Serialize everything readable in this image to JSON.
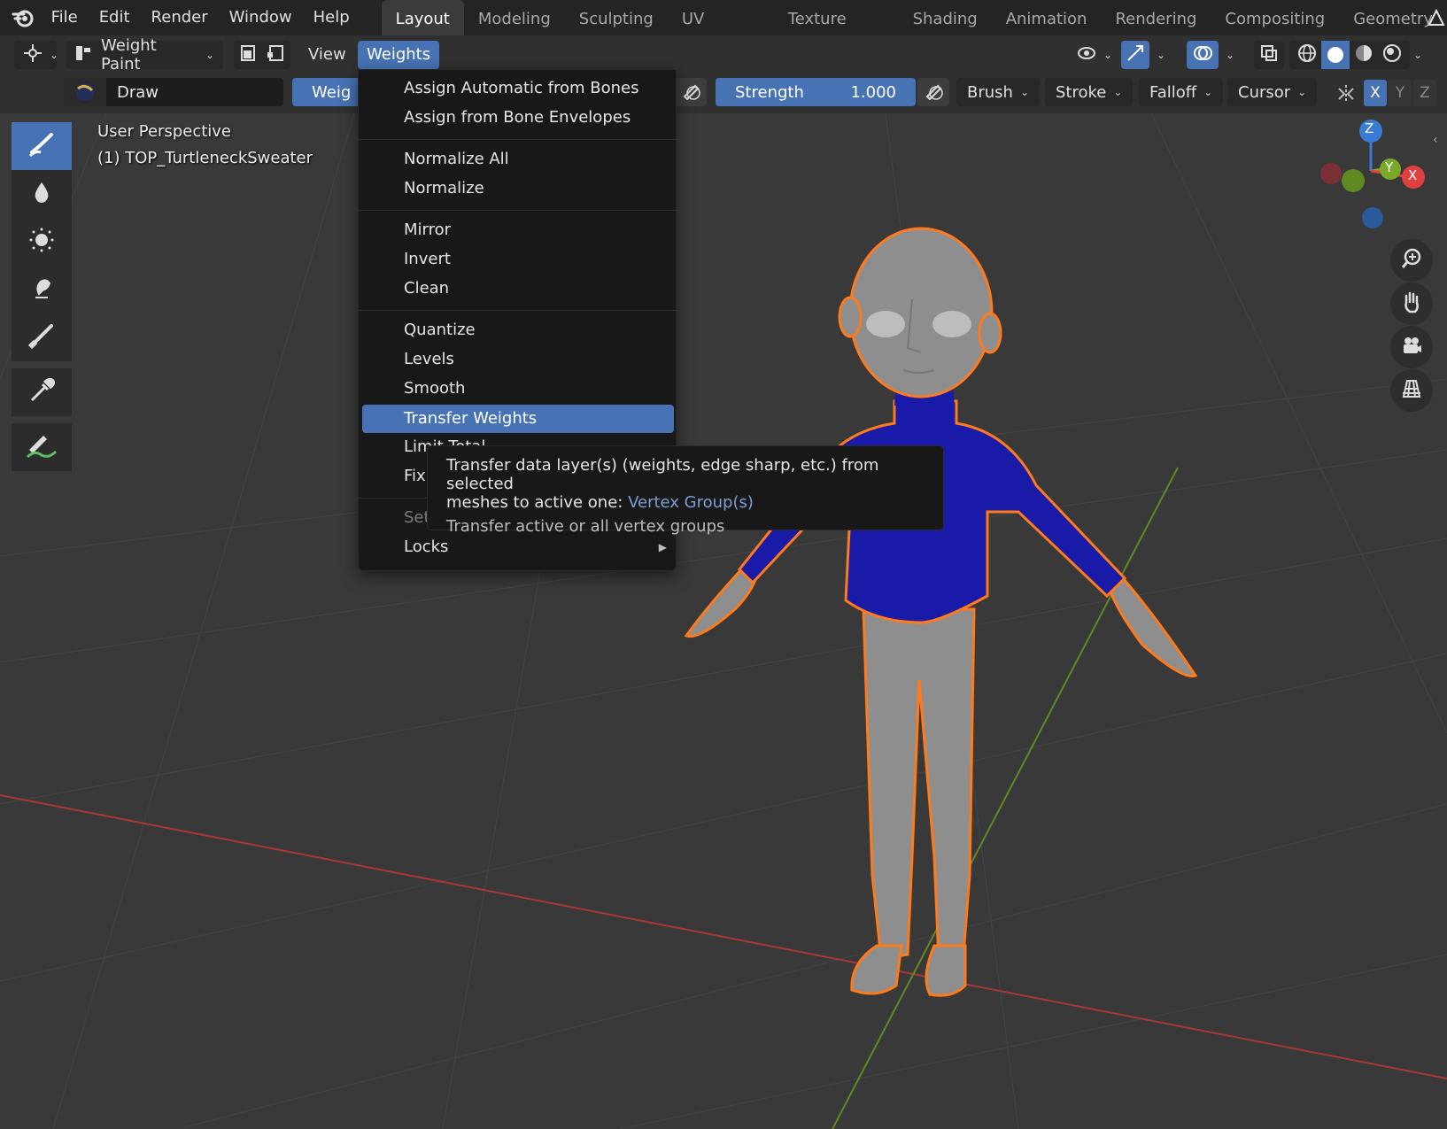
{
  "topbar": {
    "menus": [
      "File",
      "Edit",
      "Render",
      "Window",
      "Help"
    ],
    "workspace_tabs": [
      "Layout",
      "Modeling",
      "Sculpting",
      "UV Editing",
      "Texture Paint",
      "Shading",
      "Animation",
      "Rendering",
      "Compositing",
      "Geometry"
    ],
    "active_tab": "Layout"
  },
  "header": {
    "mode_label": "Weight Paint",
    "view_label": "View",
    "weights_label": "Weights"
  },
  "tool_settings": {
    "brush_name": "Draw",
    "weight_label": "Weig",
    "strength_label": "Strength",
    "strength_value": "1.000",
    "brush_dd": "Brush",
    "stroke_dd": "Stroke",
    "falloff_dd": "Falloff",
    "cursor_dd": "Cursor",
    "axis_x": "X",
    "axis_y": "Y",
    "axis_z": "Z"
  },
  "viewport": {
    "perspective_label": "User Perspective",
    "object_label": "(1) TOP_TurtleneckSweater",
    "gizmo": {
      "z": "Z",
      "y": "Y",
      "x": "X"
    }
  },
  "weights_menu": {
    "items": [
      "Assign Automatic from Bones",
      "Assign from Bone Envelopes",
      "Normalize All",
      "Normalize",
      "Mirror",
      "Invert",
      "Clean",
      "Quantize",
      "Levels",
      "Smooth",
      "Transfer Weights",
      "Limit Total",
      "Fix",
      "Set",
      "Locks"
    ],
    "highlighted": "Transfer Weights"
  },
  "tooltip": {
    "line1": "Transfer data layer(s) (weights, edge sharp, etc.) from selected",
    "line2_prefix": "meshes to active one:",
    "python_hint": "Vertex Group(s)",
    "subtext": "Transfer active or all vertex groups"
  },
  "colors": {
    "accent": "#4772b3",
    "sweater": "#1a1aa8",
    "outline": "#ff7a1a",
    "axis_red": "#c43a3a",
    "axis_green": "#6a9a2a"
  }
}
